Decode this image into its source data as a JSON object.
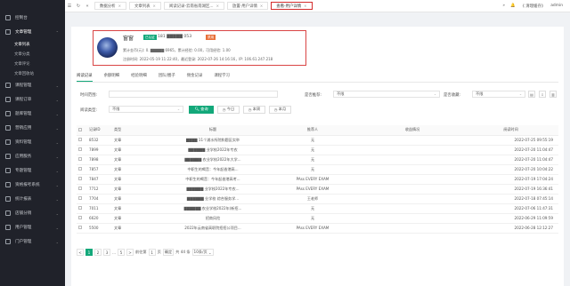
{
  "sidebar": {
    "items": [
      {
        "label": "控制台",
        "arrow": "",
        "active": false
      },
      {
        "label": "文章管理",
        "arrow": "⌃",
        "active": true
      }
    ],
    "sub_items": [
      {
        "label": "文章列表",
        "active": true
      },
      {
        "label": "文章分类",
        "active": false
      },
      {
        "label": "文章评论",
        "active": false
      },
      {
        "label": "文章回收站",
        "active": false
      }
    ],
    "items2": [
      {
        "label": "课程管理",
        "arrow": "⌄"
      },
      {
        "label": "课程订单",
        "arrow": "⌄"
      },
      {
        "label": "题库管理",
        "arrow": "⌄"
      },
      {
        "label": "营销应用",
        "arrow": "⌄"
      },
      {
        "label": "资料管理",
        "arrow": "⌄"
      },
      {
        "label": "应用服务",
        "arrow": "⌄"
      },
      {
        "label": "专题管理",
        "arrow": "⌄"
      },
      {
        "label": "资格报考系统",
        "arrow": "⌄"
      },
      {
        "label": "统计报表",
        "arrow": "⌄"
      },
      {
        "label": "店铺分销",
        "arrow": "⌄"
      },
      {
        "label": "用户管理",
        "arrow": "⌄"
      },
      {
        "label": "门户管理",
        "arrow": "⌄"
      }
    ]
  },
  "topbar": {
    "tabs": [
      {
        "label": "数据分析",
        "active": false
      },
      {
        "label": "文章列表",
        "active": false
      },
      {
        "label": "阅读记录-云南省南湖区...",
        "active": false
      },
      {
        "label": "放置-用户详情",
        "active": false
      },
      {
        "label": "查看-用户详情",
        "active": true
      }
    ],
    "admin_label": "《 清理缓存》",
    "user": "admin"
  },
  "profile": {
    "name": "窗窗",
    "badge1": "已认证",
    "phone": "181 ▇▇▇▇▇ 053",
    "badge2": "禁用",
    "line1": "累计金币(元): 0.   ▇▇▇▇▇ 6965，累计经验: 0.00，可用经验: 1.00",
    "line2": "注册时间: 2022-05-19 11:22:40，最近登录: 2022-07-26 14:16:16，IP: 106.61.247.218"
  },
  "subtabs": [
    "阅读记录",
    "余额明细",
    "经验明细",
    "团队/圈子",
    "佣金记录",
    "课程学习"
  ],
  "filters": {
    "time_label": "时间范围:",
    "preview_label": "是否推荐:",
    "preview_value": "不限",
    "collect_label": "是否收藏:",
    "collect_value": "不限",
    "type_label": "阅读类型:",
    "type_value": "不限",
    "query_btn": "查询",
    "today_btn": "今日",
    "week_btn": "本周",
    "month_btn": "本月"
  },
  "table": {
    "headers": [
      "记录ID",
      "类型",
      "标题",
      "推荐人",
      "收益情况",
      "阅读时间"
    ],
    "rows": [
      {
        "id": "8532",
        "type": "文章",
        "title": "▇▇▇▇ 11个浦水所院和题区实举",
        "ref": "无",
        "income": "",
        "time": "2022-07-25 09:55:19"
      },
      {
        "id": "7899",
        "type": "文章",
        "title": "▇▇▇▇▇▇ 业学校2022年专农",
        "ref": "无",
        "income": "",
        "time": "2022-07-20 11:04:47"
      },
      {
        "id": "7898",
        "type": "文章",
        "title": "▇▇▇▇▇▇ 农业学校2022年大学...",
        "ref": "无",
        "income": "",
        "time": "2022-07-20 11:04:47"
      },
      {
        "id": "7857",
        "type": "文章",
        "title": "中职生的喝音：今年起香港高...",
        "ref": "无",
        "income": "",
        "time": "2022-07-20 10:04:22"
      },
      {
        "id": "7847",
        "type": "文章",
        "title": "中职生的喝音：今年起香港高考...",
        "ref": "PAss EVERY EXAM",
        "income": "",
        "time": "2022-07-19 17:04:24"
      },
      {
        "id": "7712",
        "type": "文章",
        "title": "▇▇▇▇▇▇ 业学校2022年专农...",
        "ref": "PAss EVERY EXAM",
        "income": "",
        "time": "2022-07-19 16:36:41"
      },
      {
        "id": "7704",
        "type": "文章",
        "title": "▇▇▇▇▇▇ 业学校 综合服务学...",
        "ref": "王老师",
        "income": "",
        "time": "2022-07-18 07:45:14"
      },
      {
        "id": "7011",
        "type": "文章",
        "title": "▇▇▇▇▇▇ 农业学校2022年(新招...",
        "ref": "无",
        "income": "",
        "time": "2022-07-06 11:47:31"
      },
      {
        "id": "6620",
        "type": "文章",
        "title": "招商风险",
        "ref": "无",
        "income": "",
        "time": "2022-06-29 11:09:59"
      },
      {
        "id": "5500",
        "type": "文章",
        "title": "2022年云南省高职院招招公项目...",
        "ref": "PAss EVERY EXAM",
        "income": "",
        "time": "2022-06-28 12:12:27"
      }
    ]
  },
  "pager": {
    "prev": "<",
    "pages": [
      "1",
      "2",
      "3",
      "...",
      "5"
    ],
    "next": ">",
    "goto_label": "前往第",
    "goto_value": "1",
    "page_suffix": "页",
    "confirm": "确定",
    "total": "共 44 条",
    "size": "10条/页",
    "size_arrow": "⌄"
  },
  "colors": {
    "accent": "#13a87a",
    "sidebar_bg": "#20222a",
    "highlight_box": "#d94545"
  }
}
